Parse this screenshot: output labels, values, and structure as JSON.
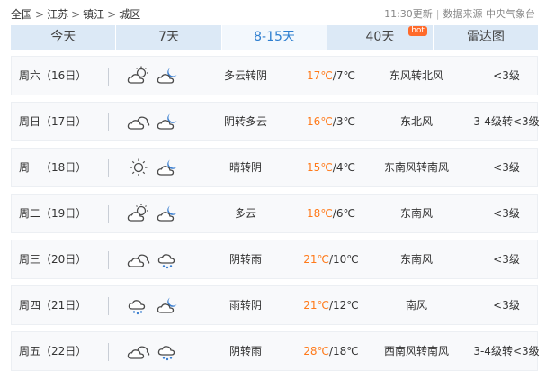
{
  "breadcrumb": {
    "level1": "全国",
    "level2": "江苏",
    "level3": "镇江",
    "level4": "城区",
    "separator": ">"
  },
  "update": {
    "time": "11:30更新",
    "source": "数据来源 中央气象台"
  },
  "tabs": [
    {
      "label": "今天"
    },
    {
      "label": "7天"
    },
    {
      "label": "8-15天"
    },
    {
      "label": "40天",
      "badge": "hot"
    },
    {
      "label": "雷达图"
    }
  ],
  "active_tab": "8-15天",
  "colors": {
    "accent": "#2f7fd0",
    "high_temp": "#ff7a1a",
    "tab_bg": "#dce9f6",
    "badge": "#ff6a2a"
  },
  "forecast": [
    {
      "day": "周六（16日）",
      "icon1": "cloudy-day-icon",
      "icon2": "cloudy-night-icon",
      "condition": "多云转阴",
      "high": "17℃",
      "low": "/7℃",
      "wind": "东风转北风",
      "level": "<3级"
    },
    {
      "day": "周日（17日）",
      "icon1": "overcast-icon",
      "icon2": "cloudy-night-icon",
      "condition": "阴转多云",
      "high": "16℃",
      "low": "/3℃",
      "wind": "东北风",
      "level": "3-4级转<3级"
    },
    {
      "day": "周一（18日）",
      "icon1": "sunny-icon",
      "icon2": "cloudy-night-icon",
      "condition": "晴转阴",
      "high": "15℃",
      "low": "/4℃",
      "wind": "东南风转南风",
      "level": "<3级"
    },
    {
      "day": "周二（19日）",
      "icon1": "cloudy-day-icon",
      "icon2": "cloudy-night-icon",
      "condition": "多云",
      "high": "18℃",
      "low": "/6℃",
      "wind": "东南风",
      "level": "<3级"
    },
    {
      "day": "周三（20日）",
      "icon1": "overcast-icon",
      "icon2": "rain-icon",
      "condition": "阴转雨",
      "high": "21℃",
      "low": "/10℃",
      "wind": "东南风",
      "level": "<3级"
    },
    {
      "day": "周四（21日）",
      "icon1": "rain-icon",
      "icon2": "cloudy-night-icon",
      "condition": "雨转阴",
      "high": "21℃",
      "low": "/12℃",
      "wind": "南风",
      "level": "<3级"
    },
    {
      "day": "周五（22日）",
      "icon1": "overcast-icon",
      "icon2": "rain-icon",
      "condition": "阴转雨",
      "high": "28℃",
      "low": "/18℃",
      "wind": "西南风转南风",
      "level": "3-4级转<3级"
    }
  ]
}
